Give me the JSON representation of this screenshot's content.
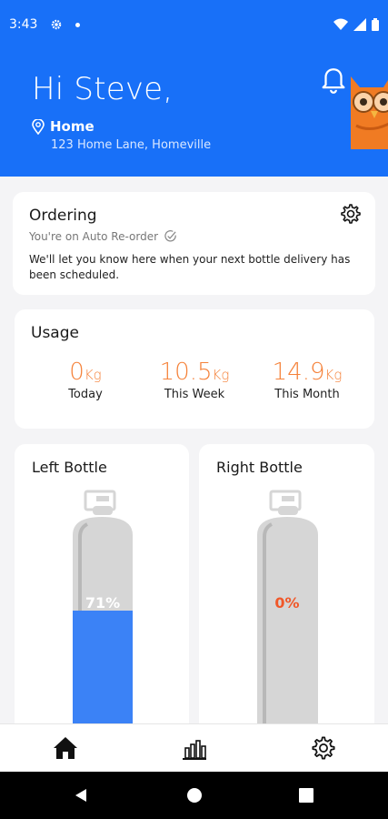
{
  "status_bar": {
    "time": "3:43"
  },
  "header": {
    "greeting": "Hi Steve,",
    "location_label": "Home",
    "address": "123 Home Lane, Homeville"
  },
  "ordering": {
    "title": "Ordering",
    "status": "You're on Auto Re-order",
    "message": "We'll let you know here when your next bottle delivery has been scheduled."
  },
  "usage": {
    "title": "Usage",
    "stats": [
      {
        "value": "0",
        "unit": "Kg",
        "label": "Today"
      },
      {
        "value": "10.5",
        "unit": "Kg",
        "label": "This Week"
      },
      {
        "value": "14.9",
        "unit": "Kg",
        "label": "This Month"
      }
    ]
  },
  "bottles": [
    {
      "title": "Left Bottle",
      "fill_label": "71%",
      "fill_fraction": 0.71
    },
    {
      "title": "Right Bottle",
      "fill_label": "0%",
      "fill_fraction": 0
    }
  ],
  "colors": {
    "brand_blue": "#1870f8",
    "accent_orange": "#f5823a",
    "bottle_gray": "#d6d6d6",
    "fill_blue": "#3b82f6",
    "empty_red": "#f0582a"
  },
  "nav": {
    "items": [
      {
        "icon": "home-icon"
      },
      {
        "icon": "bar-chart-icon"
      },
      {
        "icon": "gear-icon"
      }
    ]
  }
}
